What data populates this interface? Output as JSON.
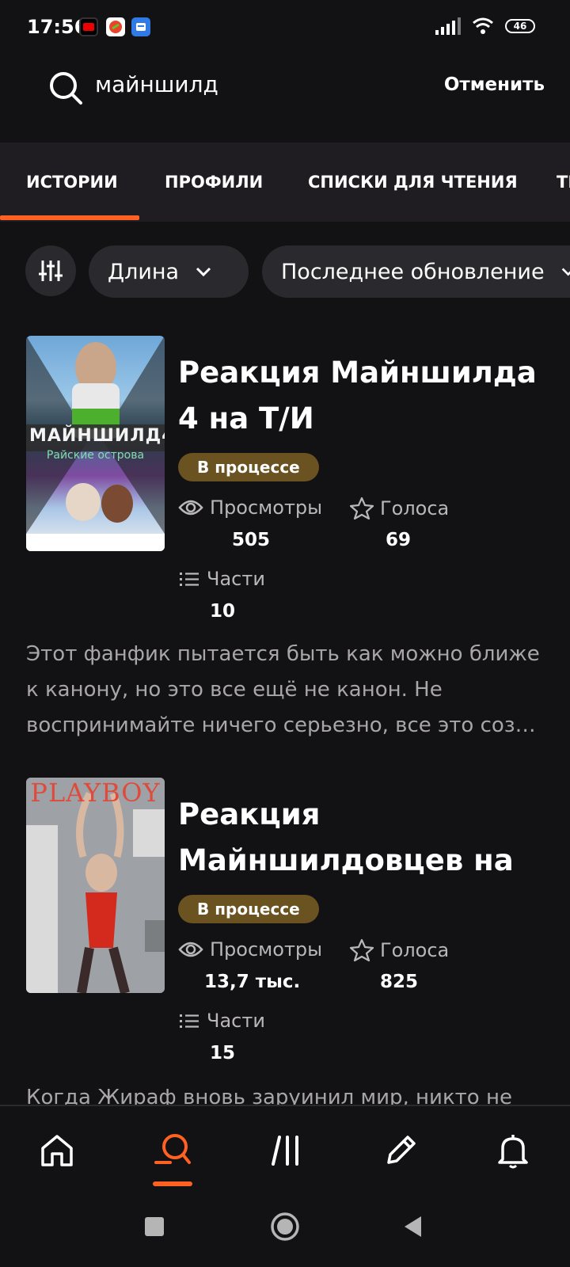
{
  "status_bar": {
    "time": "17:56",
    "battery": "46"
  },
  "search": {
    "query": "майншилд",
    "cancel_label": "Отменить"
  },
  "tabs": [
    {
      "label": "ИСТОРИИ",
      "active": true
    },
    {
      "label": "ПРОФИЛИ",
      "active": false
    },
    {
      "label": "СПИСКИ ДЛЯ ЧТЕНИЯ",
      "active": false
    },
    {
      "label": "ТЕ",
      "active": false
    }
  ],
  "filters": {
    "length_label": "Длина",
    "sort_label": "Последнее обновление"
  },
  "stories": [
    {
      "title": "Реакция Майншилда 4 на Т/И",
      "status": "В процессе",
      "views_label": "Просмотры",
      "views": "505",
      "votes_label": "Голоса",
      "votes": "69",
      "parts_label": "Части",
      "parts": "10",
      "description": "Этот фанфик пытается быть как можно ближе к канону, но это все ещё не канон. Не воспринимайте ничего серьезно, все это соз…",
      "cover_text": "МАЙНШИЛД4",
      "cover_subtitle": "Райские острова"
    },
    {
      "title": "Реакция Майншилдовцев на …",
      "status": "В процессе",
      "views_label": "Просмотры",
      "views": "13,7 тыс.",
      "votes_label": "Голоса",
      "votes": "825",
      "parts_label": "Части",
      "parts": "15",
      "description": "Когда Жираф вновь заруинил мир, никто не",
      "cover_text": "PLAYBOY"
    }
  ],
  "colors": {
    "accent": "#ff6122",
    "background": "#121114",
    "badge": "#6b5221"
  }
}
